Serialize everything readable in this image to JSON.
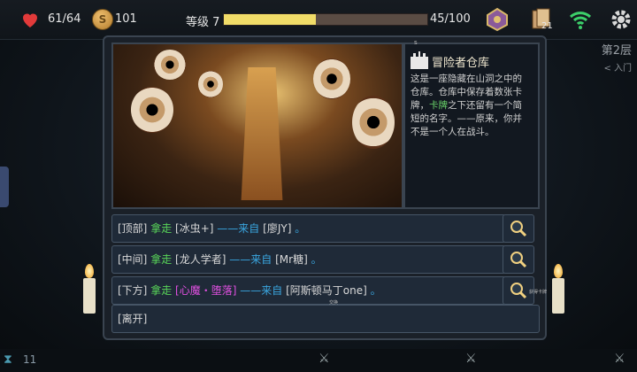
{
  "hud": {
    "hp": "61/64",
    "gold": "101",
    "level_label": "等级 7",
    "xp_text": "45/100",
    "xp_fraction": 0.45,
    "card_count": "21"
  },
  "location": {
    "title": "冒险者仓库",
    "desc_1": "这是一座隐藏在山洞之中的仓库。仓库中保存着数张卡牌，",
    "desc_highlight": "卡牌",
    "desc_2": "之下还留有一个简短的名字。——原来，你并不是一个人在战斗。",
    "top_mark": "s"
  },
  "options": [
    {
      "pos": "[顶部]",
      "take": "拿走",
      "card": "[冰虫+]",
      "from": "——来自",
      "who": "[廖JY]",
      "end": "。"
    },
    {
      "pos": "[中间]",
      "take": "拿走",
      "card": "[龙人学者]",
      "from": "——来自",
      "who": "[Mr糖]",
      "end": "。"
    },
    {
      "pos": "[下方]",
      "take": "拿走",
      "card": "[心魔・堕落]",
      "from": "——来自",
      "who": "[阿斯顿马丁one]",
      "end": "。"
    }
  ],
  "leave": "[离开]",
  "side": {
    "floor": "第2层",
    "entry": "< 入门"
  },
  "bottom": {
    "count": "11",
    "tiny_label": "交换",
    "tiny_label2": "获得卡牌"
  },
  "colors": {
    "accent_green": "#58d458",
    "accent_cyan": "#3aa6e0",
    "accent_pink": "#e050e0",
    "xp_yellow": "#f1dc68"
  }
}
